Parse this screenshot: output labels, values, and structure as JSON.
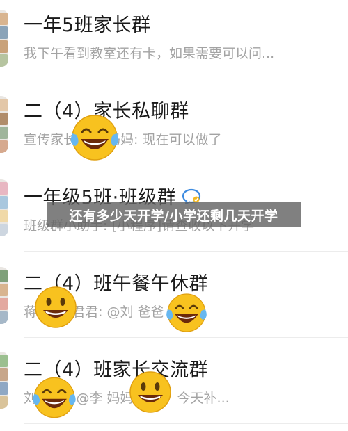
{
  "chats": [
    {
      "title": "一年5班家长群",
      "preview": "我下午看到教室还有卡，如果需要可以问..."
    },
    {
      "title": "二（4）家长私聊群",
      "preview": "宣传家长 毛春妈妈: 现在可以做了"
    },
    {
      "title": "一年级5班·班级群",
      "preview": "班级群小助手: [小程序]请查收以下开学",
      "badge_icon": "chat-bubble-icon"
    },
    {
      "title": "二（4）班午餐午休群",
      "preview": "蒋 妈妈 君君: @刘 爸爸 好的"
    },
    {
      "title": "二（4）班家长交流群",
      "preview": "刘 妈妈: @李 妈妈   好的，今天补..."
    }
  ],
  "banner": {
    "text": "还有多少天开学/小学还剩几天开学"
  },
  "stickers": [
    "laughing-tears-emoji",
    "laughing-tears-emoji",
    "smiling-emoji",
    "smiling-emoji",
    "laughing-tears-emoji"
  ],
  "colors": {
    "title": "#1a1a1a",
    "preview": "#a3a3a3",
    "emoji": "#f8c21f",
    "banner": "#606060"
  }
}
